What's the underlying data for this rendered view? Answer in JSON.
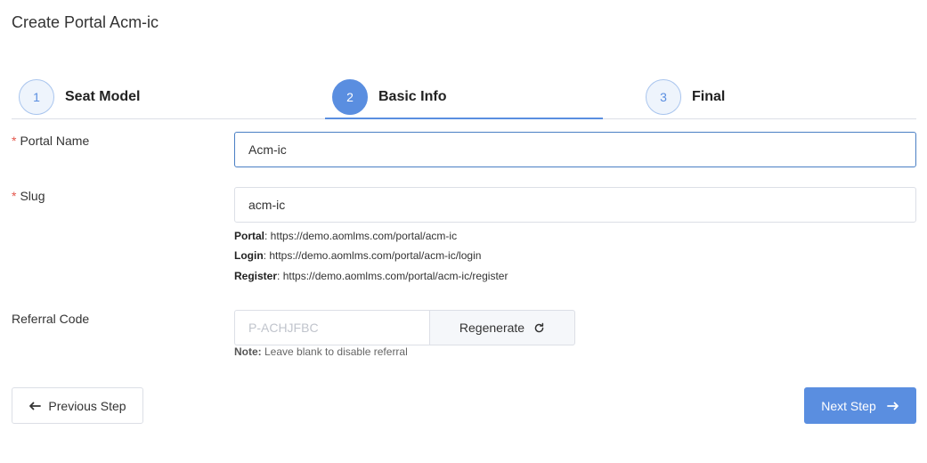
{
  "page": {
    "title": "Create Portal Acm-ic"
  },
  "steps": [
    {
      "number": "1",
      "label": "Seat Model"
    },
    {
      "number": "2",
      "label": "Basic Info"
    },
    {
      "number": "3",
      "label": "Final"
    }
  ],
  "active_step": 2,
  "form": {
    "portal_name": {
      "label": "Portal Name",
      "required_mark": "*",
      "value": "Acm-ic"
    },
    "slug": {
      "label": "Slug",
      "required_mark": "*",
      "value": "acm-ic",
      "urls": [
        {
          "key": "Portal",
          "value": ": https://demo.aomlms.com/portal/acm-ic"
        },
        {
          "key": "Login",
          "value": ": https://demo.aomlms.com/portal/acm-ic/login"
        },
        {
          "key": "Register",
          "value": ": https://demo.aomlms.com/portal/acm-ic/register"
        }
      ]
    },
    "referral_code": {
      "label": "Referral Code",
      "value": "",
      "placeholder": "P-ACHJFBC",
      "regenerate_label": "Regenerate",
      "note_key": "Note:",
      "note_text": " Leave blank to disable referral"
    }
  },
  "buttons": {
    "previous_label": "Previous Step",
    "next_label": "Next Step"
  },
  "colors": {
    "primary": "#5a8ee0",
    "required": "#e4564b"
  }
}
